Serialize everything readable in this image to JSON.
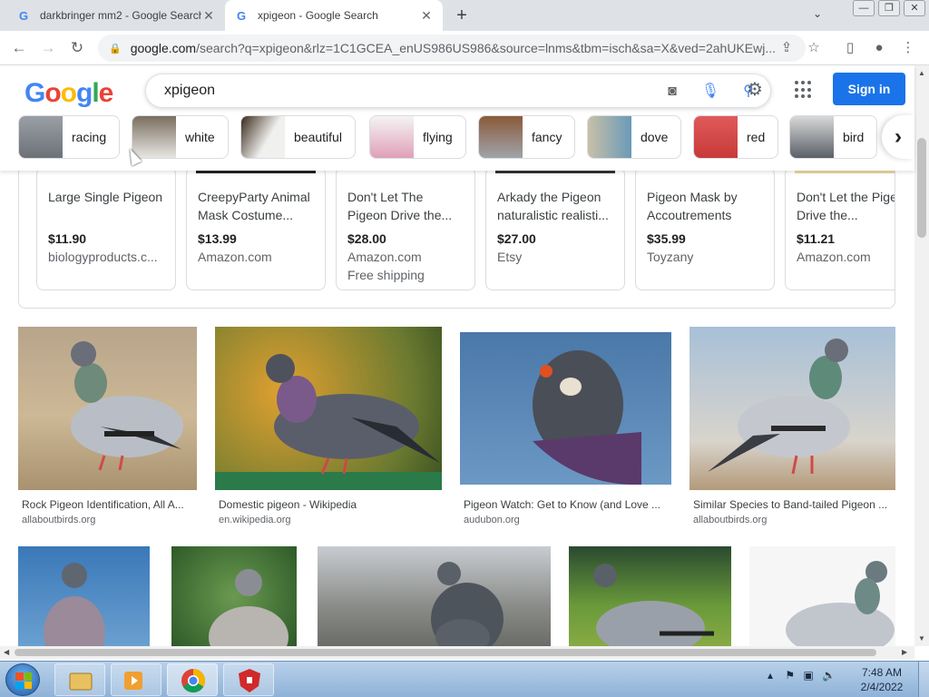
{
  "browser": {
    "tabs": [
      {
        "title": "darkbringer mm2 - Google Search",
        "active": false
      },
      {
        "title": "xpigeon - Google Search",
        "active": true
      }
    ],
    "new_tab": "+",
    "close": "✕",
    "url_domain": "google.com",
    "url_rest": "/search?q=xpigeon&rlz=1C1GCEA_enUS986US986&source=lnms&tbm=isch&sa=X&ved=2ahUKEwj...",
    "window_controls": [
      "—",
      "❐",
      "✕"
    ]
  },
  "google": {
    "logo_letters": [
      "G",
      "o",
      "o",
      "g",
      "l",
      "e"
    ],
    "search_value": "xpigeon",
    "sign_in": "Sign in",
    "chips": [
      {
        "label": "racing"
      },
      {
        "label": "white"
      },
      {
        "label": "beautiful"
      },
      {
        "label": "flying"
      },
      {
        "label": "fancy"
      },
      {
        "label": "dove"
      },
      {
        "label": "red"
      },
      {
        "label": "bird"
      }
    ],
    "chip_next": "›"
  },
  "shopping": [
    {
      "title": "Large Single Pigeon",
      "price": "$11.90",
      "store": "biologyproducts.c...",
      "shipping": ""
    },
    {
      "title": "CreepyParty Animal Mask Costume...",
      "price": "$13.99",
      "store": "Amazon.com",
      "shipping": ""
    },
    {
      "title": "Don't Let The Pigeon Drive the...",
      "price": "$28.00",
      "store": "Amazon.com",
      "shipping": "Free shipping"
    },
    {
      "title": "Arkady the Pigeon naturalistic realisti...",
      "price": "$27.00",
      "store": "Etsy",
      "shipping": ""
    },
    {
      "title": "Pigeon Mask by Accoutrements",
      "price": "$35.99",
      "store": "Toyzany",
      "shipping": ""
    },
    {
      "title": "Don't Let the Pigeon Drive the...",
      "price": "$11.21",
      "store": "Amazon.com",
      "shipping": ""
    }
  ],
  "results_row1": [
    {
      "title": "Rock Pigeon Identification, All A...",
      "source": "allaboutbirds.org"
    },
    {
      "title": "Domestic pigeon - Wikipedia",
      "source": "en.wikipedia.org"
    },
    {
      "title": "Pigeon Watch: Get to Know (and Love ...",
      "source": "audubon.org"
    },
    {
      "title": "Similar Species to Band-tailed Pigeon ...",
      "source": "allaboutbirds.org"
    }
  ],
  "taskbar": {
    "time": "7:48 AM",
    "date": "2/4/2022"
  }
}
